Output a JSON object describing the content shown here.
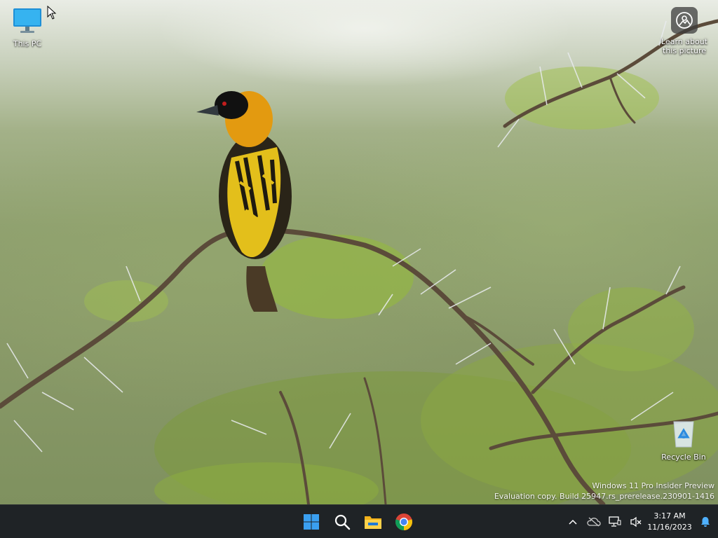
{
  "desktop": {
    "icons": [
      {
        "label": "This PC",
        "icon": "this-pc-icon"
      },
      {
        "label": "Recycle Bin",
        "icon": "recycle-bin-icon"
      }
    ],
    "learn_about_picture": {
      "line1": "Learn about",
      "line2": "this picture",
      "icon": "camera-icon"
    }
  },
  "watermark": {
    "line1": "Windows 11 Pro Insider Preview",
    "line2": "Evaluation copy. Build 25947.rs_prerelease.230901-1416"
  },
  "taskbar": {
    "pinned": [
      {
        "name": "Start",
        "icon": "windows-start-icon"
      },
      {
        "name": "Search",
        "icon": "search-icon"
      },
      {
        "name": "File Explorer",
        "icon": "file-explorer-icon"
      },
      {
        "name": "Google Chrome",
        "icon": "chrome-icon"
      }
    ],
    "tray": {
      "icons": [
        "chevron-up-icon",
        "onedrive-icon",
        "network-icon",
        "volume-muted-icon"
      ],
      "time": "3:17 AM",
      "date": "11/16/2023",
      "notification_icon": "notification-bell-icon"
    }
  },
  "colors": {
    "taskbar_bg": "#1f2326",
    "start_blue": "#3a9ff0",
    "bird_yellow": "#e8c21a",
    "foliage_green": "#8fb33a"
  }
}
